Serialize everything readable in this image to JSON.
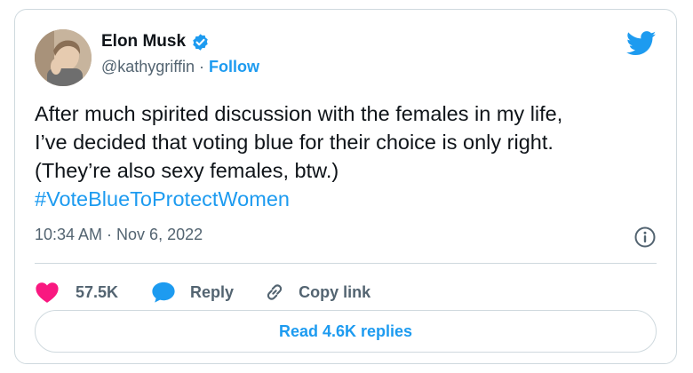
{
  "author": {
    "display_name": "Elon Musk",
    "handle": "@kathygriffin",
    "separator": "·",
    "follow_label": "Follow",
    "verified": true
  },
  "tweet": {
    "lines": [
      "After much spirited discussion with the females in my life,",
      "I’ve decided that voting blue for their choice is only right.",
      "(They’re also sexy females, btw.)"
    ],
    "hashtag": "#VoteBlueToProtectWomen",
    "timestamp": "10:34 AM · Nov 6, 2022"
  },
  "actions": {
    "likes": "57.5K",
    "reply_label": "Reply",
    "copy_link_label": "Copy link"
  },
  "read_replies_label": "Read 4.6K replies",
  "icons": {
    "brand": "twitter-bird-icon",
    "verified": "verified-badge-icon",
    "info": "info-icon",
    "like": "heart-icon",
    "reply": "speech-bubble-icon",
    "copy": "link-icon"
  },
  "colors": {
    "accent": "#1d9bf0",
    "like": "#f91880",
    "text": "#0f1419",
    "muted": "#536471",
    "border": "#cfd9de"
  }
}
